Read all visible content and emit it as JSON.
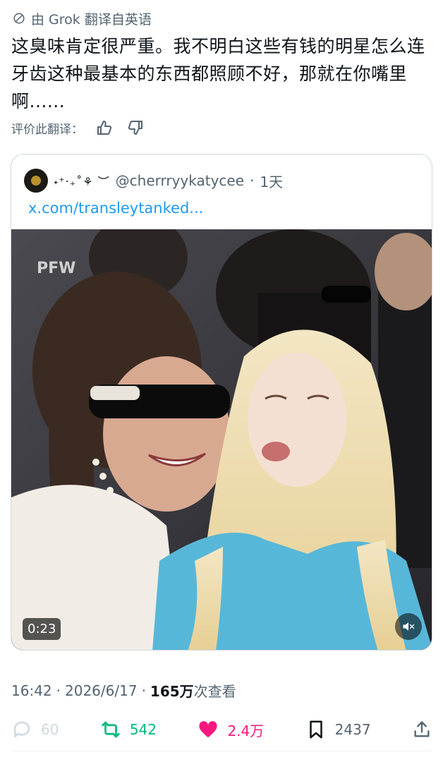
{
  "translation_header": {
    "icon": "translate-icon",
    "text": "由 Grok 翻译自英语"
  },
  "tweet": {
    "text": "这臭味肯定很严重。我不明白这些有钱的明星怎么连牙齿这种最基本的东西都照顾不好，那就在你嘴里啊......"
  },
  "rate_translation": {
    "label": "评价此翻译：",
    "icons": [
      "thumbs-up-icon",
      "thumbs-down-icon"
    ]
  },
  "quote": {
    "display_name": "˖⁺‧₊˚⚘ ︶",
    "handle": "@cherrryykatycee",
    "dot": "·",
    "time": "1天",
    "link": "x.com/transleytanked...",
    "media": {
      "duration": "0:23",
      "watermark": "PFW",
      "mute_icon": "mute-icon"
    }
  },
  "meta": {
    "time": "16:42",
    "dot": "·",
    "date": "2026/6/17",
    "dot2": "·",
    "views": "165万",
    "views_label": " 次查看"
  },
  "actions": {
    "reply": "60",
    "retweet": "542",
    "like": "2.4万",
    "bookmark": "2437"
  },
  "colors": {
    "link": "#1d9bf0",
    "retweet": "#00ba7c",
    "like": "#f91880",
    "secondary": "#536471"
  }
}
